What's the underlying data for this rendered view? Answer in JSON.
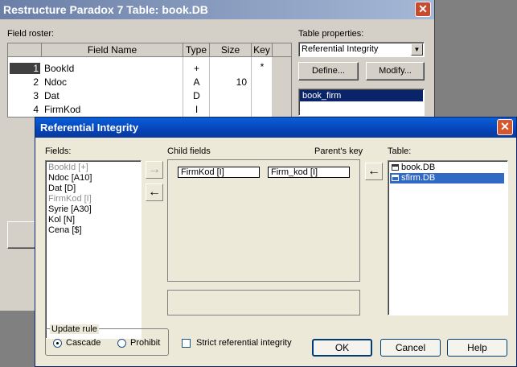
{
  "back_window": {
    "title": "Restructure Paradox 7 Table: book.DB",
    "close_glyph": "✕",
    "field_roster_label": "Field roster:",
    "table_properties_label": "Table properties:",
    "columns": [
      "Field Name",
      "Type",
      "Size",
      "Key"
    ],
    "rows": [
      {
        "num": "1",
        "name": "BookId",
        "type": "+",
        "size": "",
        "key": "*"
      },
      {
        "num": "2",
        "name": "Ndoc",
        "type": "A",
        "size": "10",
        "key": ""
      },
      {
        "num": "3",
        "name": "Dat",
        "type": "D",
        "size": "",
        "key": ""
      },
      {
        "num": "4",
        "name": "FirmKod",
        "type": "I",
        "size": "",
        "key": ""
      }
    ],
    "properties_select": "Referential Integrity",
    "define_button": "Define...",
    "modify_button": "Modify...",
    "properties_list": [
      "book_firm"
    ]
  },
  "dialog": {
    "title": "Referential Integrity",
    "close_glyph": "✕",
    "fields_label": "Fields:",
    "fields": [
      {
        "text": "BookId [+]",
        "disabled": true
      },
      {
        "text": "Ndoc [A10]",
        "disabled": false
      },
      {
        "text": "Dat [D]",
        "disabled": false
      },
      {
        "text": "FirmKod [I]",
        "disabled": true
      },
      {
        "text": "Syrie [A30]",
        "disabled": false
      },
      {
        "text": "Kol [N]",
        "disabled": false
      },
      {
        "text": "Cena [$]",
        "disabled": false
      }
    ],
    "child_fields_label": "Child fields",
    "parents_key_label": "Parent's key",
    "child_field_value": "FirmKod [I]",
    "parent_key_value": "Firm_kod [I]",
    "table_label": "Table:",
    "tables": [
      {
        "text": "book.DB",
        "selected": false
      },
      {
        "text": "sfirm.DB",
        "selected": true
      }
    ],
    "update_rule_label": "Update rule",
    "cascade_label": "Cascade",
    "prohibit_label": "Prohibit",
    "strict_label": "Strict referential integrity",
    "ok_button": "OK",
    "cancel_button": "Cancel",
    "help_button": "Help"
  }
}
